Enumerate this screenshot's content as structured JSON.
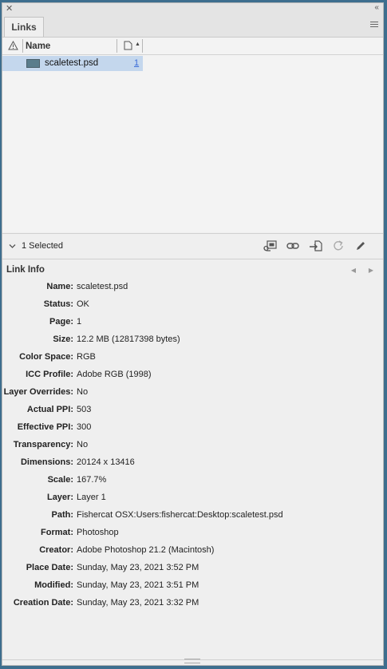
{
  "panel": {
    "close_icon": "close-icon",
    "collapse_icon": "double-chevron-left-icon",
    "tab_label": "Links",
    "menu_icon": "panel-menu-icon"
  },
  "columns": {
    "name_label": "Name"
  },
  "links": [
    {
      "name": "scaletest.psd",
      "page": "1"
    }
  ],
  "status": {
    "selected_text": "1 Selected",
    "toolbar_icons": [
      "relink-from-cc-libraries-icon",
      "relink-icon",
      "go-to-link-icon",
      "update-link-icon",
      "edit-original-icon"
    ]
  },
  "link_info": {
    "title": "Link Info",
    "fields": [
      {
        "label": "Name:",
        "value": "scaletest.psd"
      },
      {
        "label": "Status:",
        "value": "OK"
      },
      {
        "label": "Page:",
        "value": "1"
      },
      {
        "label": "Size:",
        "value": "12.2 MB (12817398 bytes)"
      },
      {
        "label": "Color Space:",
        "value": "RGB"
      },
      {
        "label": "ICC Profile:",
        "value": "Adobe RGB (1998)"
      },
      {
        "label": "Layer Overrides:",
        "value": "No"
      },
      {
        "label": "Actual PPI:",
        "value": "503"
      },
      {
        "label": "Effective PPI:",
        "value": "300"
      },
      {
        "label": "Transparency:",
        "value": "No"
      },
      {
        "label": "Dimensions:",
        "value": "20124 x 13416"
      },
      {
        "label": "Scale:",
        "value": "167.7%"
      },
      {
        "label": "Layer:",
        "value": "Layer 1"
      },
      {
        "label": "Path:",
        "value": "Fishercat OSX:Users:fishercat:Desktop:scaletest.psd"
      },
      {
        "label": "Format:",
        "value": "Photoshop"
      },
      {
        "label": "Creator:",
        "value": "Adobe Photoshop 21.2 (Macintosh)"
      },
      {
        "label": "Place Date:",
        "value": "Sunday, May 23, 2021 3:52 PM"
      },
      {
        "label": "Modified:",
        "value": "Sunday, May 23, 2021 3:51 PM"
      },
      {
        "label": "Creation Date:",
        "value": "Sunday, May 23, 2021 3:32 PM"
      }
    ]
  },
  "colors": {
    "selection": "#c4d7ed",
    "background_desktop": "#3d6e8e",
    "page_link": "#3a6cd8"
  }
}
